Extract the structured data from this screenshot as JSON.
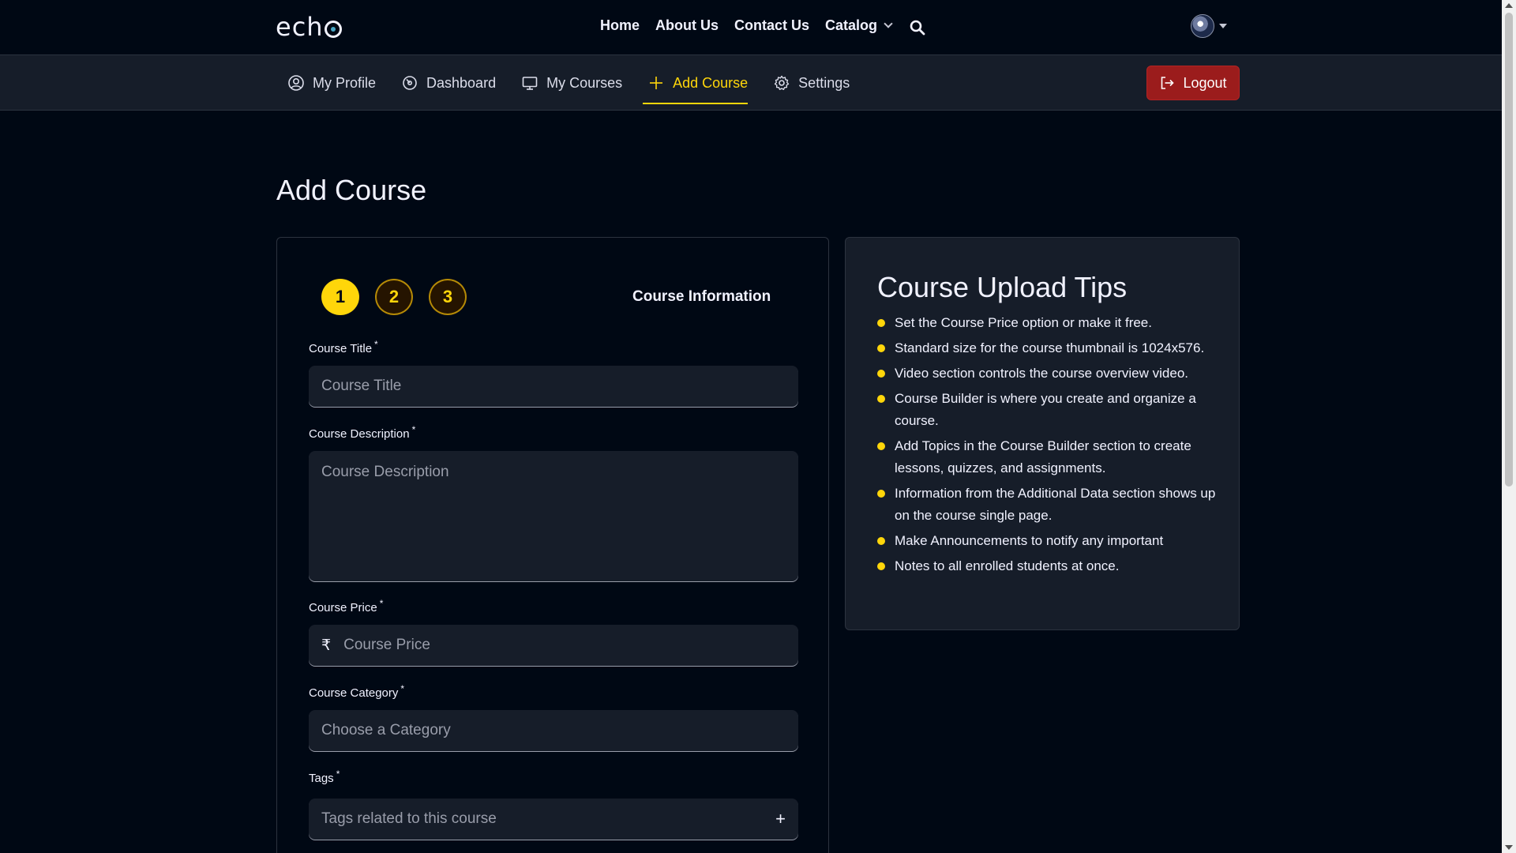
{
  "header": {
    "logo_text": "ech",
    "nav": [
      {
        "label": "Home"
      },
      {
        "label": "About Us"
      },
      {
        "label": "Contact Us"
      },
      {
        "label": "Catalog"
      }
    ]
  },
  "subnav": {
    "items": [
      {
        "label": "My Profile",
        "icon": "user-circle-icon"
      },
      {
        "label": "Dashboard",
        "icon": "dashboard-icon"
      },
      {
        "label": "My Courses",
        "icon": "monitor-icon"
      },
      {
        "label": "Add Course",
        "icon": "plus-icon"
      },
      {
        "label": "Settings",
        "icon": "gear-icon"
      }
    ],
    "active": "Add Course",
    "logout_label": "Logout"
  },
  "page": {
    "title": "Add Course"
  },
  "form": {
    "steps": [
      "1",
      "2",
      "3"
    ],
    "active_step": "1",
    "step_title": "Course Information",
    "fields": {
      "title_label": "Course Title",
      "title_placeholder": "Course Title",
      "description_label": "Course Description",
      "description_placeholder": "Course Description",
      "price_label": "Course Price",
      "price_symbol": "₹",
      "price_placeholder": "Course Price",
      "category_label": "Course Category",
      "category_placeholder": "Choose a Category",
      "tags_label": "Tags",
      "tags_placeholder": "Tags related to this course",
      "required_mark": "*"
    }
  },
  "tips": {
    "title": "Course Upload Tips",
    "items": [
      "Set the Course Price option or make it free.",
      "Standard size for the course thumbnail is 1024x576.",
      "Video section controls the course overview video.",
      "Course Builder is where you create and organize a course.",
      "Add Topics in the Course Builder section to create lessons, quizzes, and assignments.",
      "Information from the Additional Data section shows up on the course single page.",
      "Make Announcements to notify any important",
      "Notes to all enrolled students at once."
    ]
  },
  "colors": {
    "accent": "#FFD60A",
    "background": "#000814",
    "surface": "#161D29",
    "logout": "#9B1C1C"
  }
}
